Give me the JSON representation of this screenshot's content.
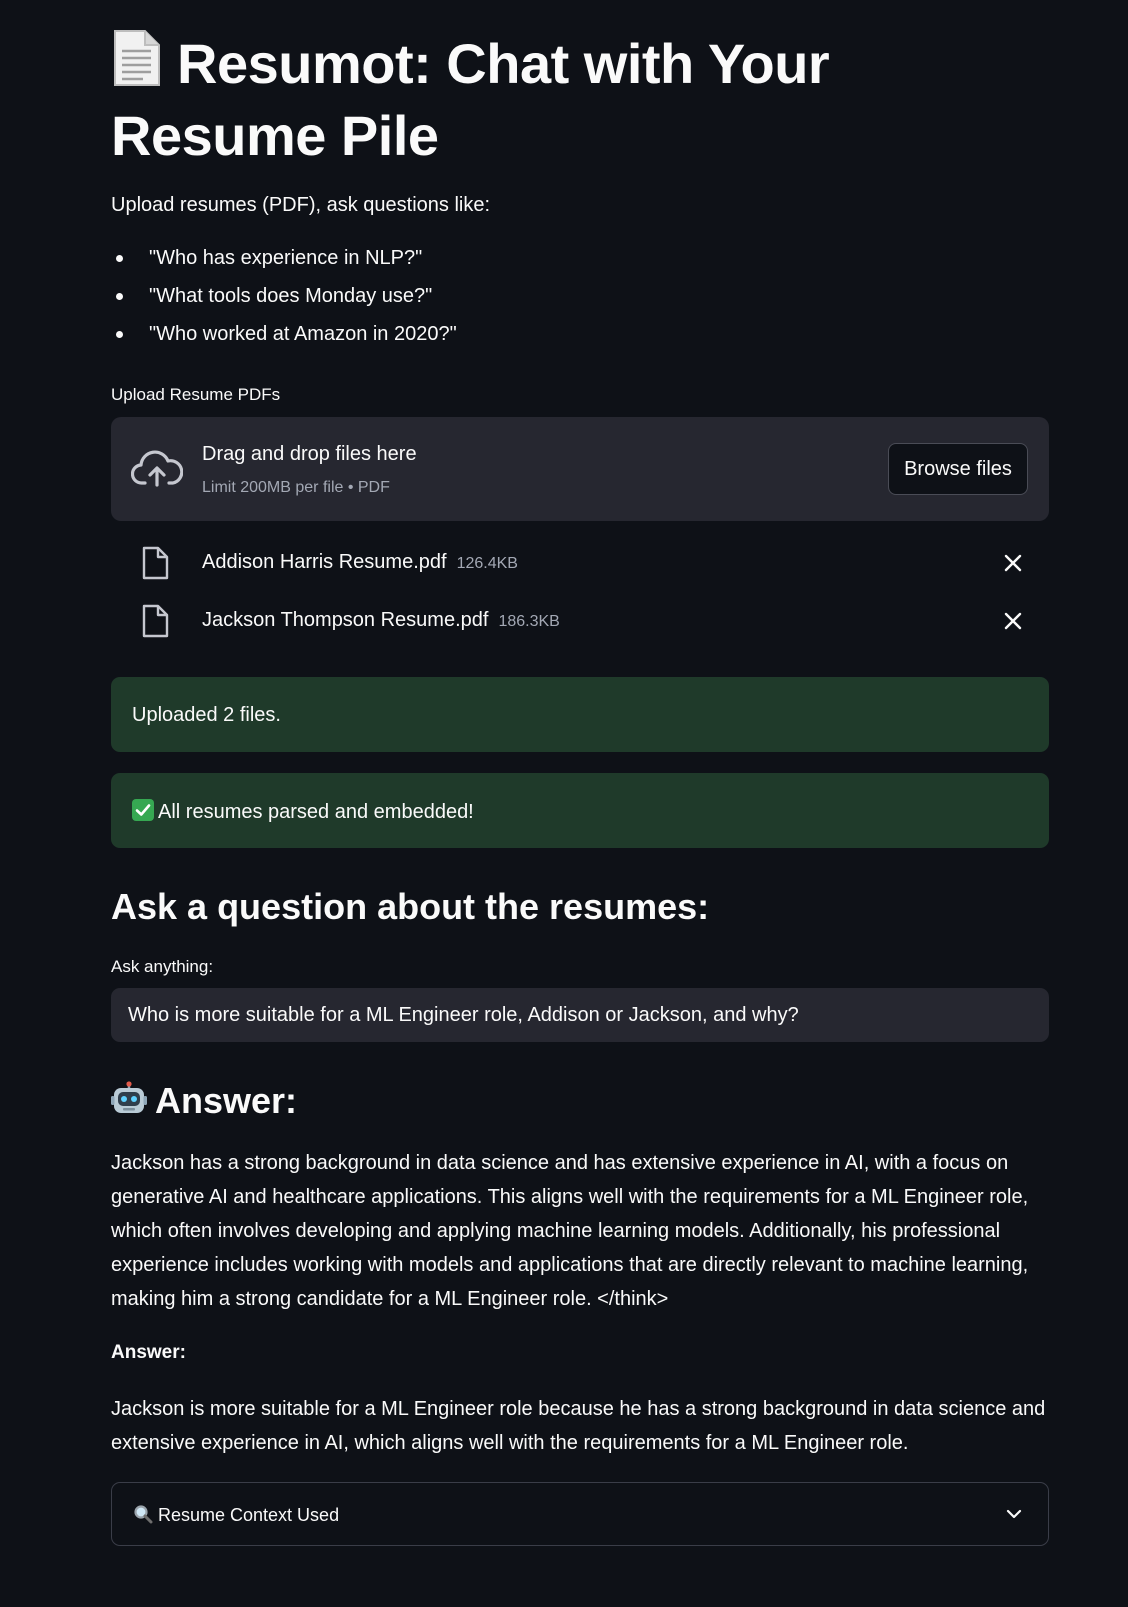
{
  "page": {
    "title": "Resumot: Chat with Your Resume Pile",
    "title_icon": "page-facing-up-emoji",
    "intro": "Upload resumes (PDF), ask questions like:",
    "examples": [
      "\"Who has experience in NLP?\"",
      "\"What tools does Monday use?\"",
      "\"Who worked at Amazon in 2020?\""
    ]
  },
  "uploader": {
    "label": "Upload Resume PDFs",
    "drop_title": "Drag and drop files here",
    "drop_limit": "Limit 200MB per file • PDF",
    "browse_label": "Browse files",
    "icon": "cloud-upload-icon",
    "files": [
      {
        "name": "Addison Harris Resume.pdf",
        "size": "126.4KB"
      },
      {
        "name": "Jackson Thompson Resume.pdf",
        "size": "186.3KB"
      }
    ]
  },
  "alerts": {
    "uploaded": "Uploaded 2 files.",
    "parsed": "All resumes parsed and embedded!",
    "success_color": "#1f3a2a"
  },
  "question": {
    "heading": "Ask a question about the resumes:",
    "label": "Ask anything:",
    "value": "Who is more suitable for a ML Engineer role, Addison or Jackson, and why?"
  },
  "answer": {
    "heading": "Answer:",
    "icon": "robot-emoji",
    "body": "Jackson has a strong background in data science and has extensive experience in AI, with a focus on generative AI and healthcare applications. This aligns well with the requirements for a ML Engineer role, which often involves developing and applying machine learning models. Additionally, his professional experience includes working with models and applications that are directly relevant to machine learning, making him a strong candidate for a ML Engineer role. </think>",
    "label": "Answer:",
    "final": "Jackson is more suitable for a ML Engineer role because he has a strong background in data science and extensive experience in AI, which aligns well with the requirements for a ML Engineer role."
  },
  "expander": {
    "label": "Resume Context Used",
    "icon": "magnifying-glass-emoji"
  },
  "theme": {
    "background": "#0e1117",
    "surface": "#262730",
    "text": "#fafafa",
    "muted": "#a3a8b4"
  }
}
